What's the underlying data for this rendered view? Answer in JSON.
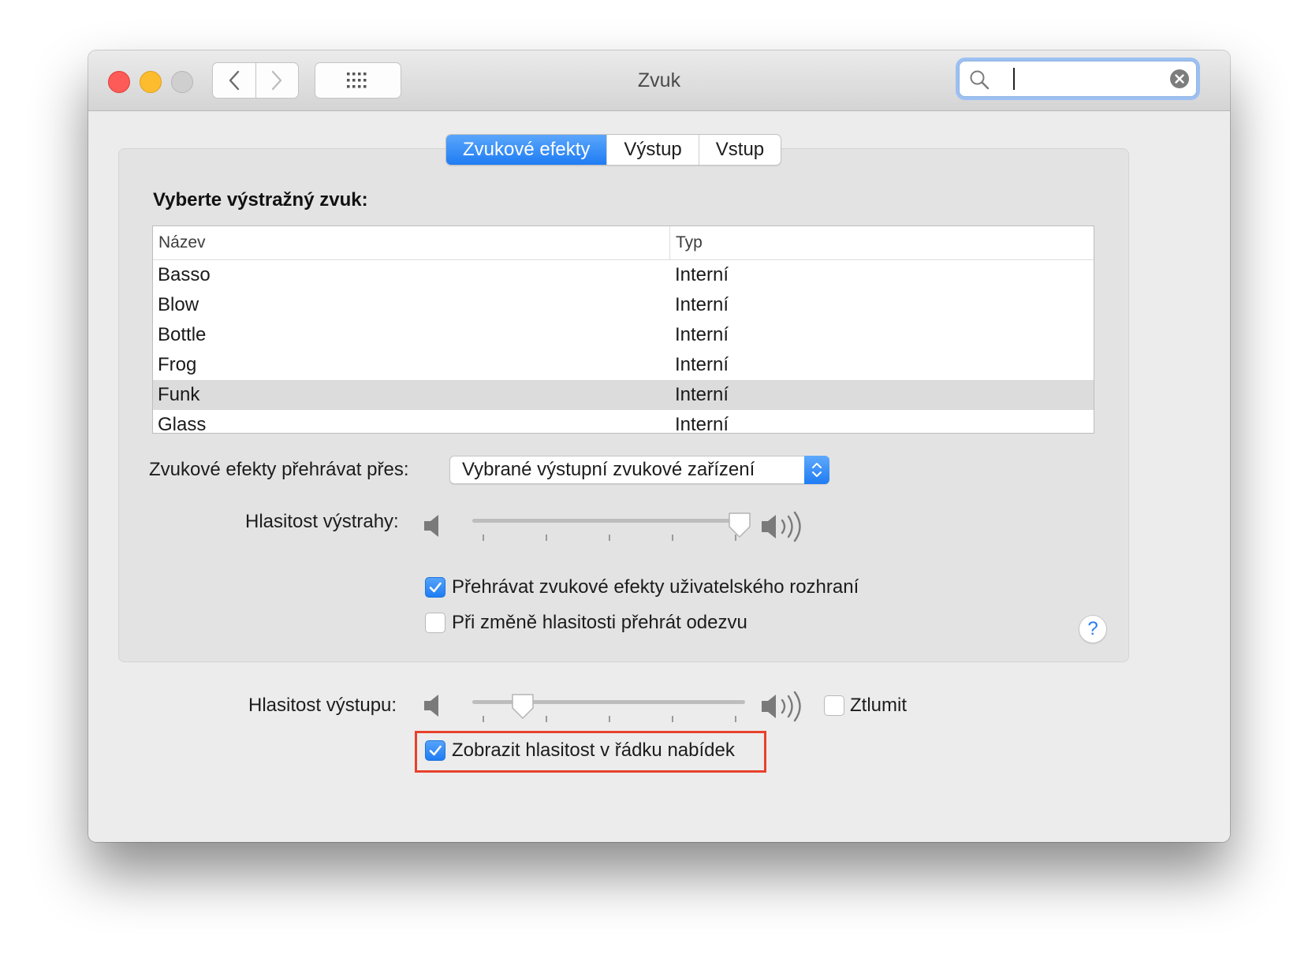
{
  "window": {
    "title": "Zvuk",
    "search": {
      "value": "",
      "placeholder": ""
    }
  },
  "tabs": [
    {
      "label": "Zvukové efekty",
      "active": true
    },
    {
      "label": "Výstup",
      "active": false
    },
    {
      "label": "Vstup",
      "active": false
    }
  ],
  "sound_effects": {
    "heading": "Vyberte výstražný zvuk:",
    "table": {
      "columns": [
        "Název",
        "Typ"
      ],
      "rows": [
        {
          "name": "Basso",
          "type": "Interní"
        },
        {
          "name": "Blow",
          "type": "Interní"
        },
        {
          "name": "Bottle",
          "type": "Interní"
        },
        {
          "name": "Frog",
          "type": "Interní"
        },
        {
          "name": "Funk",
          "type": "Interní",
          "selected": true
        },
        {
          "name": "Glass",
          "type": "Interní"
        }
      ]
    },
    "play_through_label": "Zvukové efekty přehrávat přes:",
    "play_through_value": "Vybrané výstupní zvukové zařízení",
    "alert_volume_label": "Hlasitost výstrahy:",
    "alert_volume_level": 1.0,
    "ui_sounds_label": "Přehrávat zvukové efekty uživatelského rozhraní",
    "ui_sounds_checked": true,
    "feedback_label": "Při změně hlasitosti přehrát odezvu",
    "feedback_checked": false,
    "help_label": "?"
  },
  "output": {
    "volume_label": "Hlasitost výstupu:",
    "volume_level": 0.15,
    "mute_label": "Ztlumit",
    "mute_checked": false,
    "show_in_menubar_label": "Zobrazit hlasitost v řádku nabídek",
    "show_in_menubar_checked": true
  },
  "colors": {
    "accent": "#1f7cf3",
    "highlight_box": "#e8412c",
    "close": "#fc5b57",
    "minimize": "#fdbc2e",
    "zoom_disabled": "#cfcfcf"
  },
  "icons": [
    "back-chevron-icon",
    "forward-chevron-icon",
    "grid-icon",
    "search-icon",
    "clear-icon",
    "speaker-low-icon",
    "speaker-high-icon",
    "checkmark-icon",
    "popup-arrows-icon"
  ]
}
